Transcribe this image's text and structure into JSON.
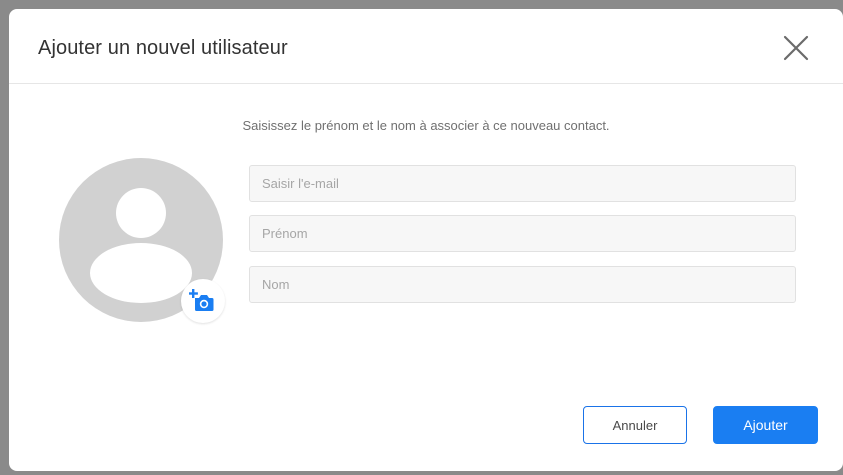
{
  "dialog": {
    "title": "Ajouter un nouvel utilisateur",
    "subtitle": "Saisissez le prénom et le nom à associer à ce nouveau contact."
  },
  "form": {
    "email_placeholder": "Saisir l'e-mail",
    "firstname_placeholder": "Prénom",
    "lastname_placeholder": "Nom"
  },
  "buttons": {
    "cancel_label": "Annuler",
    "add_label": "Ajouter"
  },
  "icons": {
    "close": "close-icon",
    "avatar": "user-avatar-icon",
    "camera": "add-photo-icon"
  },
  "colors": {
    "accent": "#1a7ef2",
    "avatar_bg": "#d1d1d1"
  }
}
